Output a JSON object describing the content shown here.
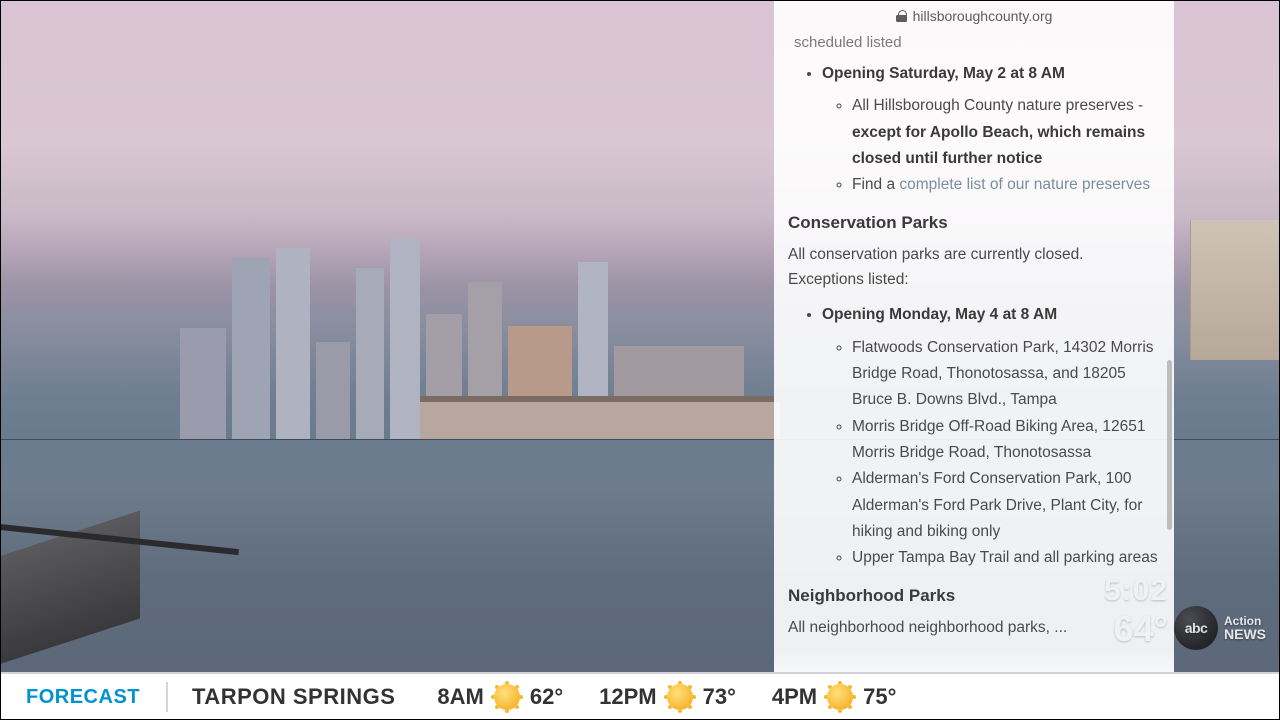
{
  "address_bar": {
    "domain": "hillsboroughcounty.org"
  },
  "truncated_top_line": "scheduled listed",
  "nature_preserves": {
    "opening_line": "Opening Saturday, May 2 at  8 AM",
    "sub_items": {
      "line1_a": "All Hillsborough County nature preserves - ",
      "line1_b_strong": "except for Apollo Beach, which remains closed until further notice",
      "line2_a": "Find a ",
      "line2_b_link": "complete list of our nature preserves"
    }
  },
  "conservation": {
    "heading": "Conservation Parks",
    "intro": "All conservation parks are currently closed. Exceptions listed:",
    "opening_line": "Opening Monday, May 4 at 8 AM",
    "items": [
      "Flatwoods Conservation Park, 14302 Morris Bridge Road, Thonotosassa, and 18205 Bruce B. Downs Blvd., Tampa",
      "Morris Bridge Off-Road Biking Area, 12651 Morris Bridge Road, Thonotosassa",
      "Alderman's Ford Conservation Park, 100 Alderman's Ford Park Drive, Plant City, for hiking and biking only",
      "Upper Tampa Bay Trail and all parking areas"
    ]
  },
  "neighborhood": {
    "heading": "Neighborhood Parks",
    "intro_truncated": "All neighborhood neighborhood parks, ..."
  },
  "clock": {
    "time": "5:02",
    "temp": "64°"
  },
  "station_logo": {
    "disc": "abc",
    "line1": "Action",
    "line2": "NEWS"
  },
  "ticker": {
    "label": "FORECAST",
    "city": "TARPON SPRINGS",
    "slots": [
      {
        "time": "8AM",
        "icon": "sunny",
        "temp": "62°"
      },
      {
        "time": "12PM",
        "icon": "sunny",
        "temp": "73°"
      },
      {
        "time": "4PM",
        "icon": "sunny",
        "temp": "75°"
      }
    ]
  }
}
